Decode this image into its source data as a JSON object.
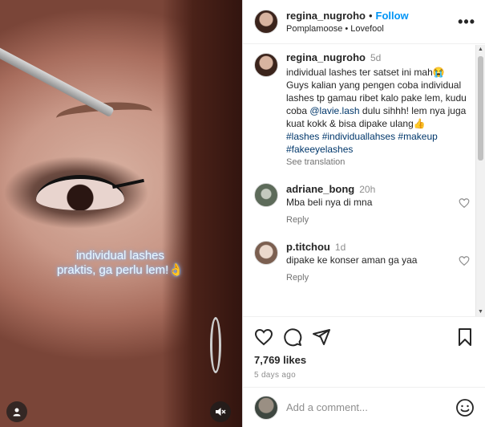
{
  "media": {
    "overlay_caption_line1": "individual lashes",
    "overlay_caption_line2": "praktis, ga perlu lem!👌",
    "user_tag_icon": "person-icon",
    "mute_icon": "speaker-muted-icon"
  },
  "header": {
    "username": "regina_nugroho",
    "separator": "•",
    "follow_label": "Follow",
    "audio": "Pomplamoose • Lovefool",
    "more_label": "•••"
  },
  "caption": {
    "username": "regina_nugroho",
    "time": "5d",
    "text_before_mention": "individual lashes ter satset ini mah😭 Guys kalian yang pengen coba individual lashes tp gamau ribet kalo pake lem, kudu coba ",
    "mention": "@lavie.lash",
    "text_after_mention": " dulu sihhh! lem nya juga kuat kokk & bisa dipake ulang👍",
    "hashtags": "#lashes #individuallahses #makeup #fakeeyelashes",
    "see_translation": "See translation"
  },
  "comments": [
    {
      "username": "adriane_bong",
      "time": "20h",
      "text": "Mba beli nya di mna",
      "reply_label": "Reply",
      "avatar_color": "#5d6b5a"
    },
    {
      "username": "p.titchou",
      "time": "1d",
      "text": "dipake ke konser aman ga yaa",
      "reply_label": "Reply",
      "avatar_color": "#c9b7a8"
    }
  ],
  "actions": {
    "icons": [
      "heart-icon",
      "comment-icon",
      "share-icon",
      "bookmark-icon"
    ],
    "likes": "7,769 likes",
    "posted_ago": "5 days ago"
  },
  "add_comment": {
    "placeholder": "Add a comment...",
    "emoji_icon": "smiley-icon"
  },
  "colors": {
    "accent": "#0095f6",
    "link": "#00376b",
    "muted": "#8e8e8e",
    "text": "#262626"
  }
}
